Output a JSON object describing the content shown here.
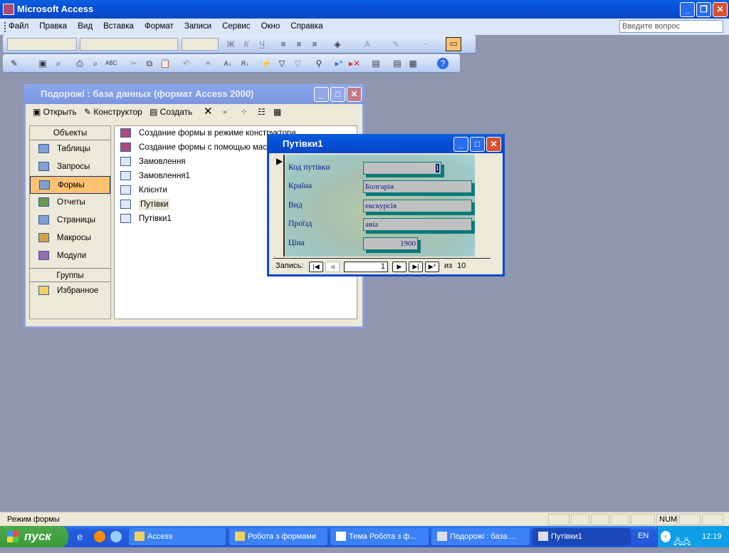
{
  "app": {
    "title": "Microsoft Access"
  },
  "menu": [
    "Файл",
    "Правка",
    "Вид",
    "Вставка",
    "Формат",
    "Записи",
    "Сервис",
    "Окно",
    "Справка"
  ],
  "ask_placeholder": "Введите вопрос",
  "toolbar_icons": [
    "bold",
    "italic",
    "underline",
    "align-left",
    "align-center",
    "align-right",
    "fill-color",
    "font-color",
    "line-color",
    "border",
    "special-effect",
    "view",
    "save",
    "search",
    "print",
    "preview",
    "spelling",
    "cut",
    "copy",
    "paste",
    "undo",
    "hyperlink",
    "sort-asc",
    "sort-desc",
    "filter-by-selection",
    "filter-by-form",
    "apply-filter",
    "find",
    "new-record",
    "delete-record",
    "properties",
    "database-window",
    "new-object",
    "help"
  ],
  "dbwin": {
    "title": "Подорожі : база данных (формат Access 2000)",
    "toolbar": {
      "open": "Открыть",
      "design": "Конструктор",
      "create": "Создать"
    },
    "objects_header": "Объекты",
    "objects": [
      "Таблицы",
      "Запросы",
      "Формы",
      "Отчеты",
      "Страницы",
      "Макросы",
      "Модули"
    ],
    "selected_object": "Формы",
    "groups_header": "Группы",
    "groups": [
      "Избранное"
    ],
    "items": [
      {
        "label": "Создание формы в режиме конструктора",
        "type": "wizard"
      },
      {
        "label": "Создание формы с помощью мастера",
        "type": "wizard"
      },
      {
        "label": "Замовлення",
        "type": "form"
      },
      {
        "label": "Замовлення1",
        "type": "form"
      },
      {
        "label": "Клієнти",
        "type": "form"
      },
      {
        "label": "Путівки",
        "type": "form"
      },
      {
        "label": "Путівки1",
        "type": "form"
      }
    ]
  },
  "form": {
    "title": "Путівки1",
    "fields": [
      {
        "label": "Код путівки",
        "value": "1"
      },
      {
        "label": "Країна",
        "value": "Болгарія"
      },
      {
        "label": "Вид",
        "value": "екскурсія"
      },
      {
        "label": "Проїзд",
        "value": "авіа"
      },
      {
        "label": "Ціна",
        "value": "1900"
      }
    ],
    "nav": {
      "label": "Запись:",
      "current": "1",
      "of": "из",
      "total": "10"
    }
  },
  "status": {
    "text": "Режим формы",
    "num": "NUM"
  },
  "taskbar": {
    "start": "пуск",
    "tasks": [
      "Access",
      "Робота з формами",
      "Тема Робота з ф...",
      "Подорожі : база ...",
      "Путівки1"
    ],
    "active_task": "Путівки1",
    "lang": "EN",
    "clock": "12:19"
  }
}
